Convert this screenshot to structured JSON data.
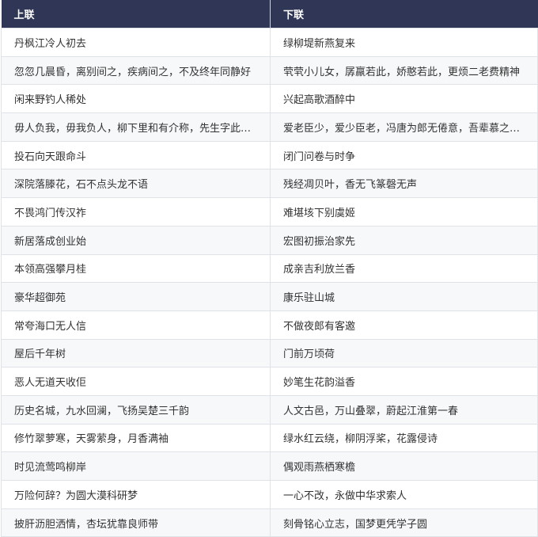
{
  "headers": [
    "上联",
    "下联"
  ],
  "rows": [
    [
      "丹枫江冷人初去",
      "绿柳堤新燕复来"
    ],
    [
      "忽忽几晨昏，离别间之，疾病间之，不及终年同静好",
      "茕茕小儿女，孱羸若此，娇憨若此，更烦二老费精神"
    ],
    [
      "闲来野钓人稀处",
      "兴起高歌酒醉中"
    ],
    [
      "毋人负我，毋我负人，柳下里和有介称，先生字此，我亦字此",
      "爱老臣少，爱少臣老，冯唐为郎无倦意，吾辈慕之，后辈慕之"
    ],
    [
      "投石向天跟命斗",
      "闭门问卷与时争"
    ],
    [
      "深院落滕花，石不点头龙不语",
      "残经凋贝叶，香无飞篆磬无声"
    ],
    [
      "不畏鸿门传汉祚",
      "难堪垓下别虞姬"
    ],
    [
      "新居落成创业始",
      "宏图初振治家先"
    ],
    [
      "本领高强攀月桂",
      "成亲吉利放兰香"
    ],
    [
      "豪华超御苑",
      "康乐驻山城"
    ],
    [
      "常夸海口无人信",
      "不做夜郎有客邀"
    ],
    [
      "屋后千年树",
      "门前万顷荷"
    ],
    [
      "恶人无道天收佢",
      "妙笔生花韵溢香"
    ],
    [
      "历史名城，九水回澜，飞扬吴楚三千韵",
      "人文古邑，万山叠翠，蔚起江淮第一春"
    ],
    [
      "修竹翠萝寒，天雾萦身，月香满袖",
      "绿水红云绕，柳阴浮桨，花露侵诗"
    ],
    [
      "时见流莺鸣柳岸",
      "偶观雨燕栖寒檐"
    ],
    [
      "万险何辞？为圆大漠科研梦",
      "一心不改，永做中华求索人"
    ],
    [
      "披肝沥胆洒情，杏坛犹靠良师带",
      "刻骨铭心立志，国梦更凭学子圆"
    ]
  ]
}
